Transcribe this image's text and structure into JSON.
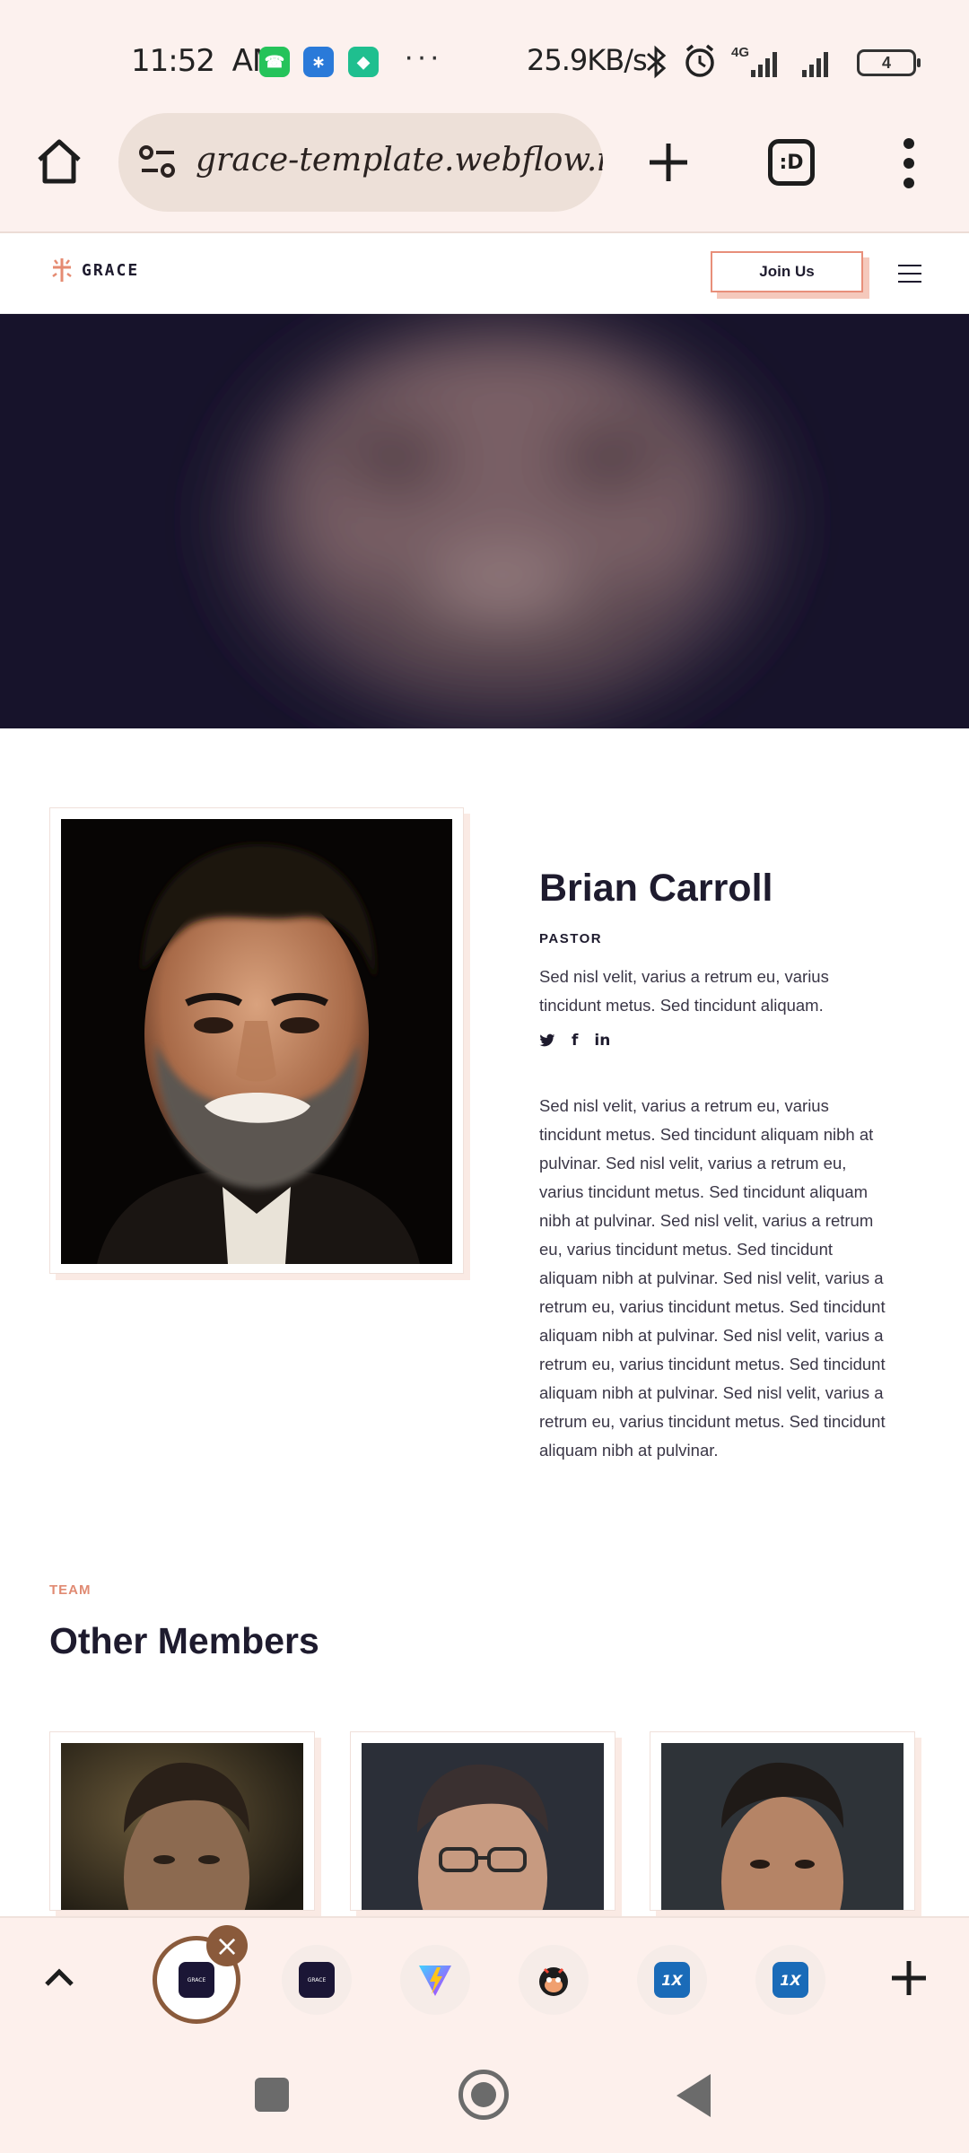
{
  "status_bar": {
    "time": "11:52",
    "ampm": "AM",
    "speed": "25.9KB/s",
    "network": "4G",
    "battery": "4"
  },
  "browser": {
    "url": "grace-template.webflow.io"
  },
  "site": {
    "logo_text": "GRACE",
    "join_label": "Join Us"
  },
  "profile": {
    "name": "Brian Carroll",
    "role": "PASTOR",
    "short_bio": "Sed nisl velit, varius a retrum eu, varius tincidunt metus. Sed tincidunt aliquam.",
    "long_bio": "Sed nisl velit, varius a retrum eu, varius tincidunt metus. Sed tincidunt aliquam nibh at pulvinar. Sed nisl velit, varius a retrum eu, varius tincidunt metus. Sed tincidunt aliquam nibh at pulvinar. Sed nisl velit, varius a retrum eu, varius tincidunt metus. Sed tincidunt aliquam nibh at pulvinar. Sed nisl velit, varius a retrum eu, varius tincidunt metus. Sed tincidunt aliquam nibh at pulvinar. Sed nisl velit, varius a retrum eu, varius tincidunt metus. Sed tincidunt aliquam nibh at pulvinar. Sed nisl velit, varius a retrum eu, varius tincidunt metus. Sed tincidunt aliquam nibh at pulvinar.",
    "socials": [
      "twitter-icon",
      "facebook-icon",
      "linkedin-icon"
    ]
  },
  "team": {
    "eyebrow": "TEAM",
    "title": "Other Members"
  },
  "tab_strip": {
    "grace_mini_label": "GRACE",
    "onex_label": "1X"
  },
  "colors": {
    "accent": "#e08a72",
    "dark": "#1e1b2e",
    "chrome_bg": "#fcf1ee",
    "tab_active": "#8a5a3b"
  }
}
